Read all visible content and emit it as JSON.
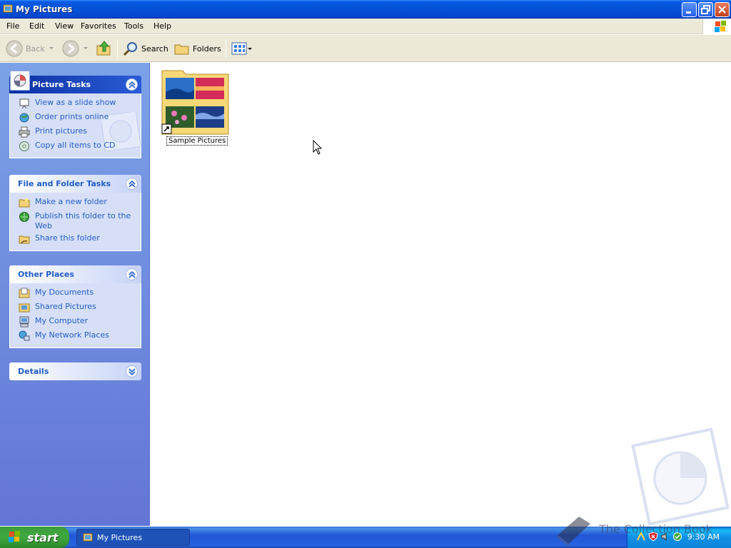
{
  "window": {
    "title": "My Pictures"
  },
  "menu": [
    "File",
    "Edit",
    "View",
    "Favorites",
    "Tools",
    "Help"
  ],
  "toolbar": {
    "back": "Back",
    "search": "Search",
    "folders": "Folders"
  },
  "panels": {
    "picture_tasks": {
      "title": "Picture Tasks",
      "items": [
        "View as a slide show",
        "Order prints online",
        "Print pictures",
        "Copy all items to CD"
      ]
    },
    "file_folder_tasks": {
      "title": "File and Folder Tasks",
      "items": [
        "Make a new folder",
        "Publish this folder to the Web",
        "Share this folder"
      ]
    },
    "other_places": {
      "title": "Other Places",
      "items": [
        "My Documents",
        "Shared Pictures",
        "My Computer",
        "My Network Places"
      ]
    },
    "details": {
      "title": "Details"
    }
  },
  "content": {
    "items": [
      {
        "name": "Sample Pictures",
        "icon": "folder-with-thumbnails-shortcut"
      }
    ]
  },
  "taskbar": {
    "start": "start",
    "window_button": "My Pictures",
    "clock": "9:30 AM"
  },
  "watermark": "The Collection Book",
  "colors": {
    "title_blue": "#0453d8",
    "task_link": "#215dc6",
    "pane_blue": "#6f8ddf",
    "start_green": "#3fa83f"
  }
}
